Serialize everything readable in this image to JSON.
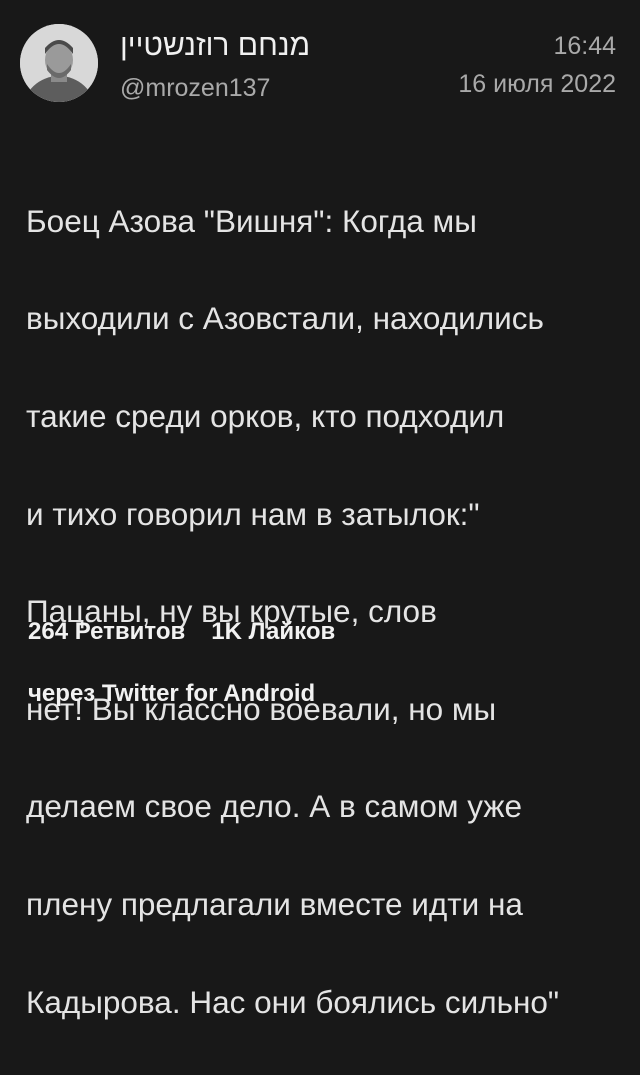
{
  "author": {
    "display_name": "מנחם רוזנשטיין",
    "handle": "@mrozen137",
    "avatar": "user-avatar-photo"
  },
  "meta": {
    "time": "16:44",
    "date": "16 июля 2022"
  },
  "tweet": {
    "lines": [
      "Боец Азова \"Вишня\": Когда мы",
      "выходили с Азовстали, находились",
      "такие среди орков, кто подходил",
      "и тихо говорил нам в затылок:\"",
      "Пацаны, ну вы крутые, слов",
      "нет! Вы классно воевали, но мы",
      "делаем свое дело. А в самом уже",
      "плену предлагали вместе идти на",
      "Кадырова. Нас они боялись сильно\""
    ]
  },
  "stats": {
    "retweets": "264 Ретвитов",
    "likes": "1K Лайков"
  },
  "source": {
    "via": "через Twitter for Android"
  },
  "colors": {
    "background": "#181818",
    "text_primary": "#e4e4e4",
    "text_secondary": "#a9a9a9"
  }
}
